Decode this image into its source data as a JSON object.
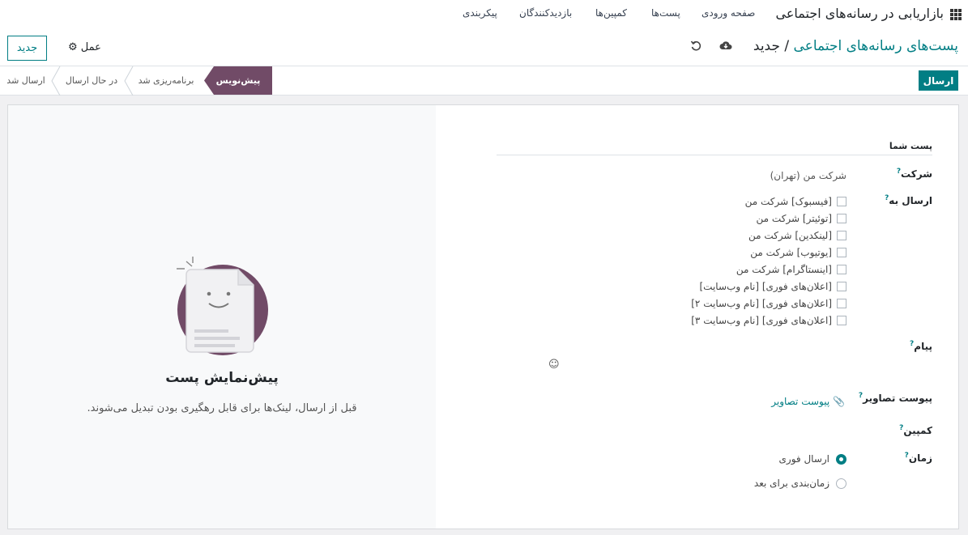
{
  "topnav": {
    "app_name": "بازاریابی در رسانه‌های اجتماعی",
    "menu": [
      "صفحه ورودی",
      "پست‌ها",
      "کمپین‌ها",
      "بازدیدکنندگان",
      "پیکربندی"
    ]
  },
  "control": {
    "breadcrumb_parent": "پست‌های رسانه‌های اجتماعی",
    "breadcrumb_sep": " / ",
    "breadcrumb_current": "جدید",
    "new_label": "جدید",
    "action_label": "عمل"
  },
  "statusbar": {
    "send_label": "ارسال",
    "stages": [
      "پیش‌نویس",
      "برنامه‌ریزی شد",
      "در حال ارسال",
      "ارسال شد"
    ],
    "active_stage": "پیش‌نویس"
  },
  "form": {
    "section_title": "پست شما",
    "company_label": "شرکت",
    "company_value": "شرکت من (تهران)",
    "send_to_label": "ارسال به",
    "accounts": [
      "[فیسبوک] شرکت من",
      "[توئیتر] شرکت من",
      "[لینکدین] شرکت من",
      "[یوتیوب] شرکت من",
      "[اینستاگرام] شرکت من",
      "[اعلان‌های فوری] [نام وب‌سایت]",
      "[اعلان‌های فوری] [نام وب‌سایت ۲]",
      "[اعلان‌های فوری] [نام وب‌سایت ۳]"
    ],
    "message_label": "پیام",
    "attach_label": "پیوست تصاویر",
    "attach_button": "پیوست تصاویر",
    "campaign_label": "کمپین",
    "timing_label": "زمان",
    "timing_options": [
      "ارسال فوری",
      "زمان‌بندی برای بعد"
    ],
    "timing_selected": "ارسال فوری"
  },
  "preview": {
    "title": "پیش‌نمایش پست",
    "description": "قبل از ارسال، لینک‌ها برای قابل رهگیری بودن تبدیل می‌شوند."
  },
  "colors": {
    "accent": "#017e84",
    "stage_active": "#714b67"
  }
}
